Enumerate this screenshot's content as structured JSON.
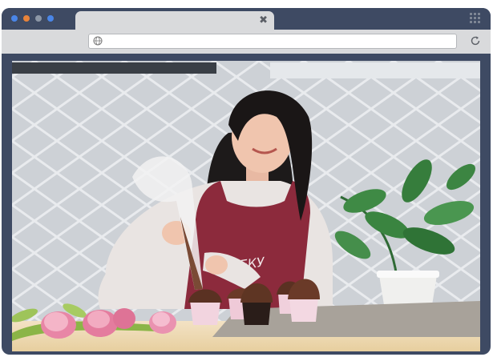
{
  "window": {
    "controls": [
      "close-dot",
      "minimize-dot",
      "maximize-dot",
      "extra-dot"
    ],
    "control_colors": [
      "#4a86e8",
      "#e8833a",
      "#8d97a6",
      "#4a86e8"
    ]
  },
  "tab": {
    "title": "",
    "close_glyph": "✖"
  },
  "address_bar": {
    "url": ""
  },
  "icons": {
    "menu": "app-grid-icon",
    "address": "globe-icon",
    "reload": "reload-icon"
  },
  "content": {
    "image_subject": "baker-decorating-cupcakes",
    "apron_text": "ЛЕКУ"
  },
  "colors": {
    "frame": "#3e4a63",
    "chrome": "#d9dadc",
    "apron": "#8c2a3c"
  }
}
